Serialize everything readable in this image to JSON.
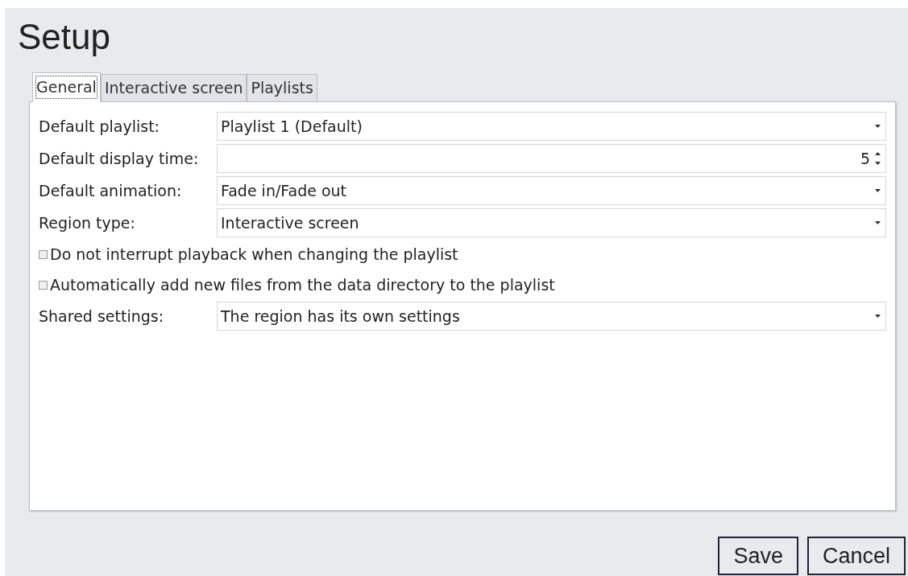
{
  "title": "Setup",
  "tabs": [
    {
      "label": "General",
      "selected": true
    },
    {
      "label": "Interactive screen",
      "selected": false
    },
    {
      "label": "Playlists",
      "selected": false
    }
  ],
  "fields": [
    {
      "kind": "select",
      "label": "Default playlist:",
      "value": "Playlist 1 (Default)"
    },
    {
      "kind": "spin",
      "label": "Default display time:",
      "value": "5"
    },
    {
      "kind": "select",
      "label": "Default animation:",
      "value": "Fade in/Fade out"
    },
    {
      "kind": "select",
      "label": "Region type:",
      "value": "Interactive screen"
    },
    {
      "kind": "checkbox",
      "label": "Do not interrupt playback when changing the playlist",
      "checked": false
    },
    {
      "kind": "checkbox",
      "label": "Automatically add new files from the data directory to the playlist",
      "checked": false
    },
    {
      "kind": "select",
      "label": "Shared settings:",
      "value": "The region has its own settings"
    }
  ],
  "buttons": [
    "Save",
    "Cancel"
  ]
}
